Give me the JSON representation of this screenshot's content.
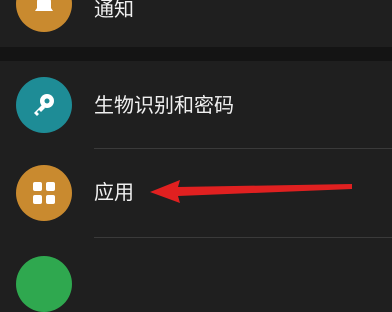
{
  "settings_items": [
    {
      "label": "通知",
      "icon": "bell-icon",
      "color": "#c98a2f"
    },
    {
      "label": "生物识别和密码",
      "icon": "key-icon",
      "color": "#1e8c96"
    },
    {
      "label": "应用",
      "icon": "apps-grid-icon",
      "color": "#c98a2f"
    },
    {
      "label": "",
      "icon": "generic-icon",
      "color": "#2fa84f"
    }
  ],
  "annotation": {
    "type": "arrow",
    "color": "#e02020"
  }
}
